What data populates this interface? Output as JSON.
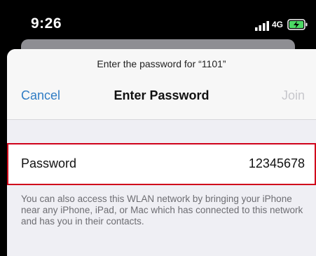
{
  "status_bar": {
    "time": "9:26",
    "network": "4G",
    "signal_icon": "signal-bars-icon",
    "battery_icon": "battery-charging-icon",
    "battery_color": "#4cd964"
  },
  "sheet": {
    "prompt": "Enter the password for “1101”",
    "cancel_label": "Cancel",
    "title": "Enter Password",
    "join_label": "Join",
    "accent_color": "#2f7cc4"
  },
  "password_field": {
    "label": "Password",
    "value": "12345678"
  },
  "note": "You can also access this WLAN network by bringing your iPhone near any iPhone, iPad, or Mac which has connected to this network and has you in their contacts."
}
